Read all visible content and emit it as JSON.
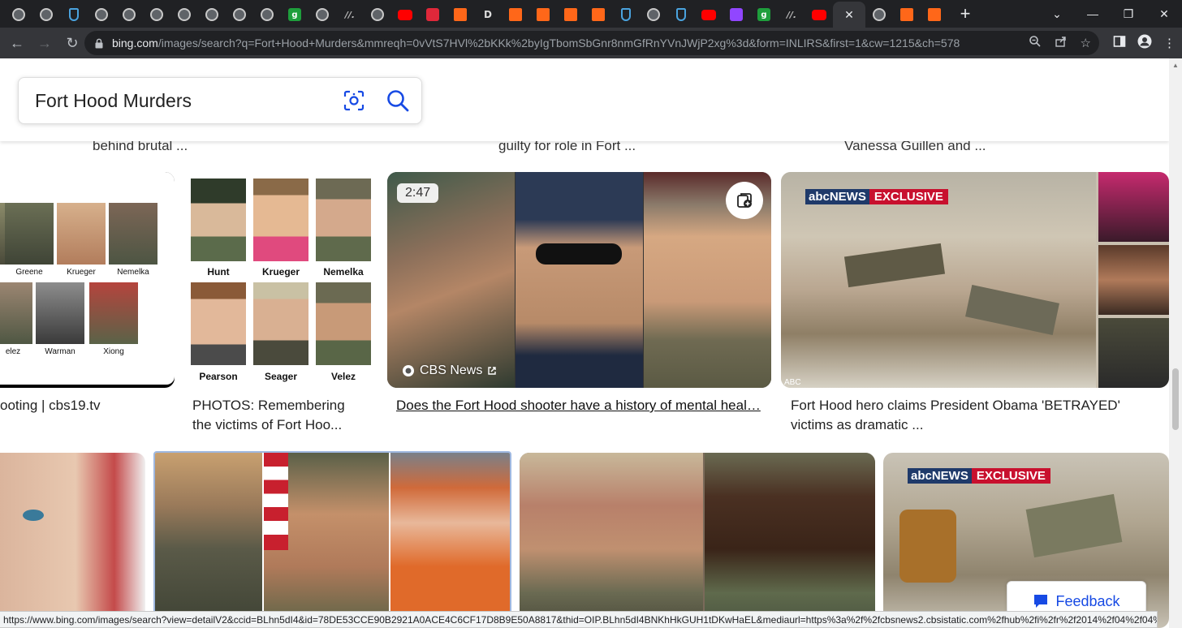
{
  "browser": {
    "tabs": [
      {
        "icon": "globe-icon",
        "kind": "globe"
      },
      {
        "icon": "globe-icon",
        "kind": "globe"
      },
      {
        "icon": "shield-icon",
        "kind": "shield"
      },
      {
        "icon": "globe-icon",
        "kind": "globe"
      },
      {
        "icon": "globe-icon",
        "kind": "globe"
      },
      {
        "icon": "globe-icon",
        "kind": "globe"
      },
      {
        "icon": "globe-icon",
        "kind": "globe"
      },
      {
        "icon": "globe-icon",
        "kind": "globe"
      },
      {
        "icon": "globe-icon",
        "kind": "globe"
      },
      {
        "icon": "globe-icon",
        "kind": "globe"
      },
      {
        "icon": "green-g-icon",
        "kind": "green",
        "glyph": "g"
      },
      {
        "icon": "globe-icon",
        "kind": "globe"
      },
      {
        "icon": "slash-icon",
        "kind": "slash",
        "glyph": "//."
      },
      {
        "icon": "globe-icon",
        "kind": "globe"
      },
      {
        "icon": "youtube-icon",
        "kind": "yt"
      },
      {
        "icon": "red-app-icon",
        "kind": "red"
      },
      {
        "icon": "substack-icon",
        "kind": "orange"
      },
      {
        "icon": "d-icon",
        "kind": "dark",
        "glyph": "D"
      },
      {
        "icon": "substack-icon",
        "kind": "orange"
      },
      {
        "icon": "substack-icon",
        "kind": "orange"
      },
      {
        "icon": "substack-icon",
        "kind": "orange"
      },
      {
        "icon": "substack-icon",
        "kind": "orange"
      },
      {
        "icon": "shield-icon",
        "kind": "shield"
      },
      {
        "icon": "globe-icon",
        "kind": "globe"
      },
      {
        "icon": "shield-icon",
        "kind": "shield"
      },
      {
        "icon": "youtube-icon",
        "kind": "yt"
      },
      {
        "icon": "twitch-icon",
        "kind": "purple"
      },
      {
        "icon": "green-g-icon",
        "kind": "green",
        "glyph": "g"
      },
      {
        "icon": "slash-icon",
        "kind": "slash",
        "glyph": "//."
      },
      {
        "icon": "youtube-icon",
        "kind": "yt"
      }
    ],
    "after_active_tabs": [
      {
        "icon": "globe-icon",
        "kind": "globe"
      },
      {
        "icon": "substack-icon",
        "kind": "orange"
      },
      {
        "icon": "substack-icon",
        "kind": "orange"
      }
    ],
    "url_host": "bing.com",
    "url_path": "/images/search?q=Fort+Hood+Murders&mmreqh=0vVtS7HVl%2bKKk%2byIgTbomSbGnr8nmGfRnYVnJWjP2xg%3d&form=INLIRS&first=1&cw=1215&ch=578",
    "status_url": "https://www.bing.com/images/search?view=detailV2&ccid=BLhn5dI4&id=78DE53CCE90B2921A0ACE4C6CF17D8B9E50A8817&thid=OIP.BLhn5dI4BNKhHkGUH1tDKwHaEL&mediaurl=https%3a%2f%2fcbsnews2.cbsistatic.com%2fhub%2fi%2fr%2f2014%2f04%2f04%2f24886e87-44d4..."
  },
  "search": {
    "query": "Fort Hood Murders"
  },
  "top_captions": {
    "left": "behind brutal ...",
    "middle": "guilty for role in Fort ...",
    "right": "Vanessa Guillen and ..."
  },
  "row1": {
    "card1": {
      "caption": "ooting | cbs19.tv",
      "names_top": [
        "Greene",
        "Krueger",
        "Nemelka"
      ],
      "names_bottom": [
        "elez",
        "Warman",
        "Xiong"
      ]
    },
    "card2": {
      "caption_line1": "PHOTOS: Remembering",
      "caption_line2": "the victims of Fort Hoo...",
      "names_top": [
        "Hunt",
        "Krueger",
        "Nemelka"
      ],
      "names_bottom": [
        "Pearson",
        "Seager",
        "Velez"
      ]
    },
    "card3": {
      "duration": "2:47",
      "source": "CBS News",
      "caption": "Does the Fort Hood shooter have a history of mental heal…"
    },
    "card4": {
      "badge_brand": "abcNEWS",
      "badge_tag": "EXCLUSIVE",
      "corner_mark": "ABC",
      "caption_line1": "Fort Hood hero claims President Obama 'BETRAYED'",
      "caption_line2": "victims as dramatic ..."
    }
  },
  "row2": {
    "card4": {
      "badge_brand": "abcNEWS",
      "badge_tag": "EXCLUSIVE"
    }
  },
  "feedback_label": "Feedback"
}
